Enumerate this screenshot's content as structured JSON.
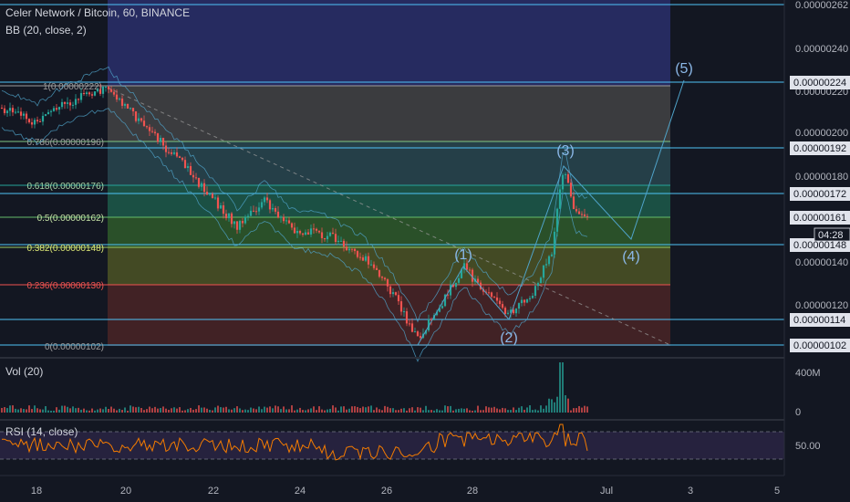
{
  "header": {
    "title": "Celer Network / Bitcoin, 60, BINANCE",
    "indicator": "BB (20, close, 2)"
  },
  "volume_panel": {
    "label": "Vol (20)",
    "ticks": [
      "400M",
      "0"
    ]
  },
  "rsi_panel": {
    "label": "RSI (14, close)",
    "ticks": [
      "50.00"
    ]
  },
  "price_axis": {
    "ticks": [
      "0.00000262",
      "0.00000240",
      "0.00000220",
      "0.00000200",
      "0.00000180",
      "0.00000140",
      "0.00000120"
    ],
    "markers": [
      {
        "label": "0.00000224",
        "color": "#1e222d"
      },
      {
        "label": "0.00000192",
        "color": "#1e222d"
      },
      {
        "label": "0.00000172",
        "color": "#1e222d"
      },
      {
        "label": "0.00000161",
        "color": "#1e222d"
      },
      {
        "label": "0.00000148",
        "color": "#1e222d"
      },
      {
        "label": "0.00000114",
        "color": "#1e222d"
      },
      {
        "label": "0.00000102",
        "color": "#1e222d"
      }
    ],
    "countdown": "04:28"
  },
  "time_axis": {
    "ticks": [
      "18",
      "20",
      "22",
      "24",
      "26",
      "28",
      "Jul",
      "3",
      "5"
    ]
  },
  "fib_levels": [
    {
      "label": "1(0.00000222)",
      "color": "#787b86"
    },
    {
      "label": "0.786(0.00000196)",
      "color": "#81c784"
    },
    {
      "label": "0.618(0.00000176)",
      "color": "#26a69a"
    },
    {
      "label": "0.5(0.00000162)",
      "color": "#4caf50"
    },
    {
      "label": "0.382(0.00000148)",
      "color": "#9acd32"
    },
    {
      "label": "0.236(0.00000130)",
      "color": "#f23645"
    },
    {
      "label": "0(0.00000102)",
      "color": "#787b86"
    }
  ],
  "waves": [
    "(1)",
    "(2)",
    "(3)",
    "(4)",
    "(5)"
  ],
  "colors": {
    "up": "#26a69a",
    "down": "#ef5350",
    "wave": "#5b9bd5",
    "line": "#4fc3f7",
    "rsi": "#f57c00"
  }
}
